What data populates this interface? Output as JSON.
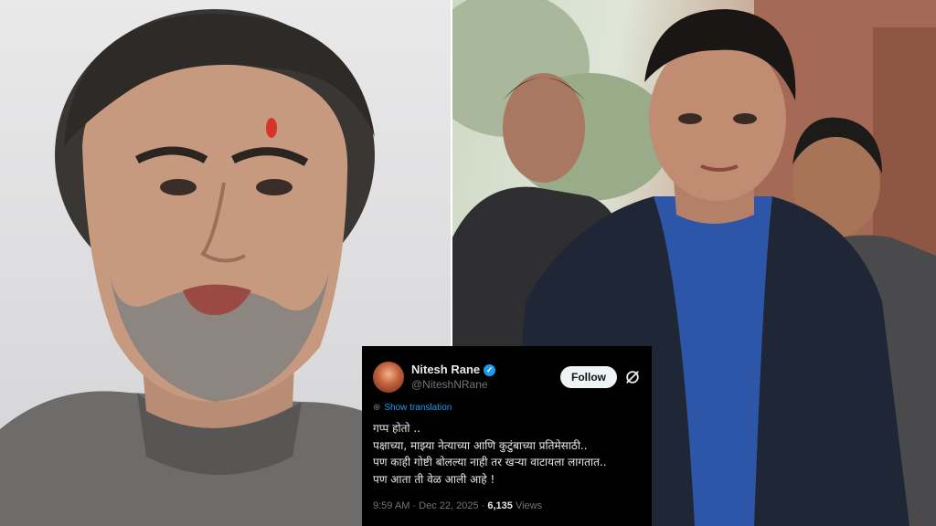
{
  "tweet": {
    "name": "Nitesh Rane",
    "handle": "@NiteshNRane",
    "follow_label": "Follow",
    "translate_label": "Show translation",
    "lines": [
      "गप्प होतो ..",
      "पक्षाच्या, माझ्या नेत्याच्या आणि कुटुंबाच्या प्रतिमेसाठी..",
      "पण काही गोष्टी बोलल्या नाही तर खऱ्या वाटायला लागतात..",
      "पण आता ती वेळ आली आहे !"
    ],
    "time": "9:59 AM · Dec 22, 2025 · ",
    "views_count": "6,135",
    "views_label": " Views",
    "icons": {
      "verified": "verified-badge-icon",
      "grok": "grok-icon",
      "translate": "globe-icon"
    }
  },
  "colors": {
    "tweet_bg": "#000000",
    "follow_bg": "#eff3f4",
    "verified": "#1d9bf0",
    "link": "#1d9bf0"
  }
}
